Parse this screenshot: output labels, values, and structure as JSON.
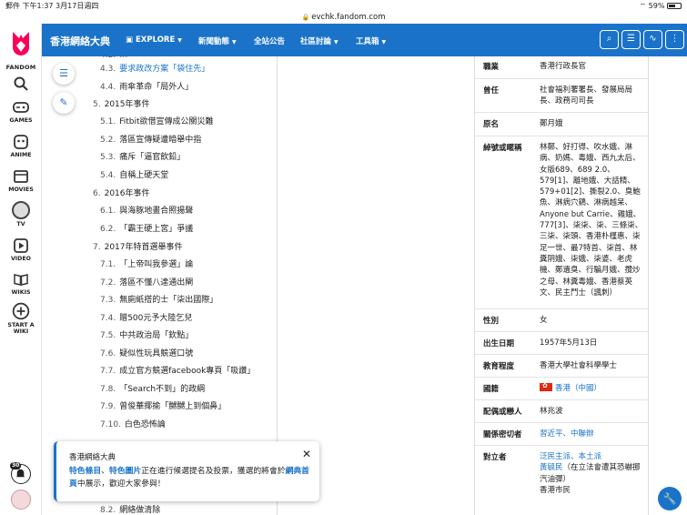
{
  "status_bar": {
    "left": "郵件  下午1:37  3月17日週四",
    "battery": "59%"
  },
  "url": "evchk.fandom.com",
  "rail": {
    "logo_text": "FANDOM",
    "items": [
      {
        "label": ""
      },
      {
        "label": "GAMES"
      },
      {
        "label": "ANIME"
      },
      {
        "label": "MOVIES"
      },
      {
        "label": "TV"
      },
      {
        "label": "VIDEO"
      },
      {
        "label": "WIKIS"
      },
      {
        "label": "START A WIKI"
      }
    ],
    "notifications": "30"
  },
  "nav": {
    "wiki_name": "香港網絡大典",
    "menus": [
      "EXPLORE",
      "新聞動態",
      "全站公告",
      "社區討論",
      "工具箱"
    ]
  },
  "toc": [
    {
      "num": "4.3.",
      "text": "要求政改方案「袋住先」"
    },
    {
      "num": "4.4.",
      "text": "雨傘革命「局外人」"
    },
    {
      "num": "5.",
      "text": "2015年事件"
    },
    {
      "num": "5.1.",
      "text": "Fitbit欲借宣傳成公關災難"
    },
    {
      "num": "5.2.",
      "text": "落區宣傳疑遭暗舉中指"
    },
    {
      "num": "5.3.",
      "text": "痛斥「逼官飲鉛」"
    },
    {
      "num": "5.4.",
      "text": "自稱上硬天堂"
    },
    {
      "num": "6.",
      "text": "2016年事件"
    },
    {
      "num": "6.1.",
      "text": "與海豚地畫合照揚聲"
    },
    {
      "num": "6.2.",
      "text": "「霸王硬上宮」爭議"
    },
    {
      "num": "7.",
      "text": "2017年特首選舉事件"
    },
    {
      "num": "7.1.",
      "text": "「上帝叫我參選」論"
    },
    {
      "num": "7.2.",
      "text": "落區不懂八達通出閘"
    },
    {
      "num": "7.3.",
      "text": "無廁紙搭的士「柒出國際」"
    },
    {
      "num": "7.4.",
      "text": "贈500元予大陸乞兒"
    },
    {
      "num": "7.5.",
      "text": "中共政治局「欽點」"
    },
    {
      "num": "7.6.",
      "text": "疑似性玩具競選口號"
    },
    {
      "num": "7.7.",
      "text": "成立官方競選facebook專頁「吸讚」"
    },
    {
      "num": "7.8.",
      "text": "「Search不到」的政綱"
    },
    {
      "num": "7.9.",
      "text": "曾俊華揶揄「嬲嬲上到個鼻」"
    },
    {
      "num": "7.10.",
      "text": "白色恐怖論"
    },
    {
      "num": "8.2.",
      "text": "網絡做清除"
    }
  ],
  "infobox": {
    "rows": [
      {
        "label": "職業",
        "value": "香港行政長官"
      },
      {
        "label": "曾任",
        "value": "社會福利署署長、發展局局長、政務司司長"
      },
      {
        "label": "原名",
        "value": "鄭月娥"
      },
      {
        "label": "綽號或暱稱",
        "value": "林鄭、好打得、吹水娥、淋病、奶媽、毒娥、西九太后、女版689、689 2.0、579[1]、離地娥、大話精、579+01[2]、撕裂2.0、臭鮑魚、淋病穴鷄、淋病越呆、Anyone but Carrie、雞娥、777[3]、柒柒、柒、三條柒、三柒、柒頭、香港朴槿惠、柒足一世、最7特首、柒首、林糞阴娥、柒娥、柒婆、老虎機、鄭遺臭、行騙月娥、攬炒之母、林糞毒娥、香港蔡英文、民主鬥士（諷刺）"
      },
      {
        "label": "性別",
        "value": "女"
      },
      {
        "label": "出生日期",
        "value": "1957年5月13日"
      },
      {
        "label": "教育程度",
        "value": "香港大學社會科學學士"
      },
      {
        "label": "國籍",
        "value": "香港（中國）"
      },
      {
        "label": "配偶或戀人",
        "value": "林兆波"
      },
      {
        "label": "關係密切者",
        "value": "習近平、中聯辦"
      },
      {
        "label": "對立者",
        "value_link": "泛民主派、本土派",
        "value_link2": "黃毓民",
        "value_rest": "（在立法會遭其恐嚇挪汽油彈）",
        "value_tail": "香港市民"
      }
    ]
  },
  "notice": {
    "title": "香港網絡大典",
    "link1": "特色條目",
    "sep": "、",
    "link2": "特色圖片",
    "mid": "正在進行候選提名及投票，獲選的將會於",
    "link3": "網典首頁",
    "end": "中展示，歡迎大家參與！"
  },
  "colors": {
    "accent": "#1a73c9",
    "fandom_red": "#fa005a"
  }
}
